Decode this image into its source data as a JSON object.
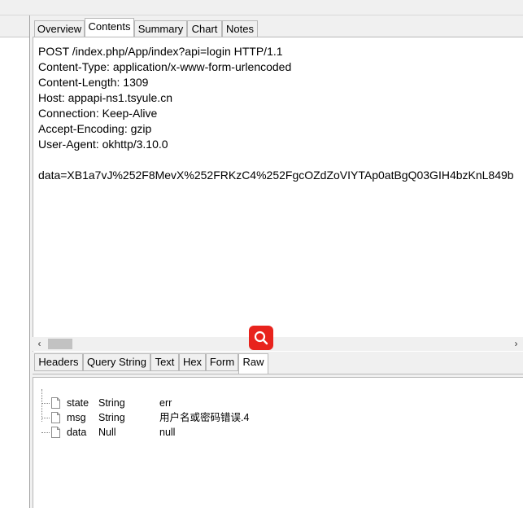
{
  "tabs_top": [
    {
      "label": "Overview",
      "active": false
    },
    {
      "label": "Contents",
      "active": true
    },
    {
      "label": "Summary",
      "active": false
    },
    {
      "label": "Chart",
      "active": false
    },
    {
      "label": "Notes",
      "active": false
    }
  ],
  "request": {
    "lines": [
      "POST /index.php/App/index?api=login HTTP/1.1",
      "Content-Type: application/x-www-form-urlencoded",
      "Content-Length: 1309",
      "Host: appapi-ns1.tsyule.cn",
      "Connection: Keep-Alive",
      "Accept-Encoding: gzip",
      "User-Agent: okhttp/3.10.0",
      "",
      "data=XB1a7vJ%252F8MevX%252FRKzC4%252FgcOZdZoVIYTAp0atBgQ03GIH4bzKnL849b"
    ]
  },
  "scroll": {
    "left_icon": "scroll-left-arrow",
    "right_icon": "scroll-right-arrow"
  },
  "tabs_bottom": [
    {
      "label": "Headers",
      "active": false
    },
    {
      "label": "Query String",
      "active": false
    },
    {
      "label": "Text",
      "active": false
    },
    {
      "label": "Hex",
      "active": false
    },
    {
      "label": "Form",
      "active": false
    },
    {
      "label": "Raw",
      "active": true
    }
  ],
  "search_button": {
    "icon": "search-icon",
    "color": "#e8231d"
  },
  "tree": [
    {
      "key": "state",
      "type": "String",
      "value": "err"
    },
    {
      "key": "msg",
      "type": "String",
      "value": "用户名或密码错误.4"
    },
    {
      "key": "data",
      "type": "Null",
      "value": "null"
    }
  ]
}
